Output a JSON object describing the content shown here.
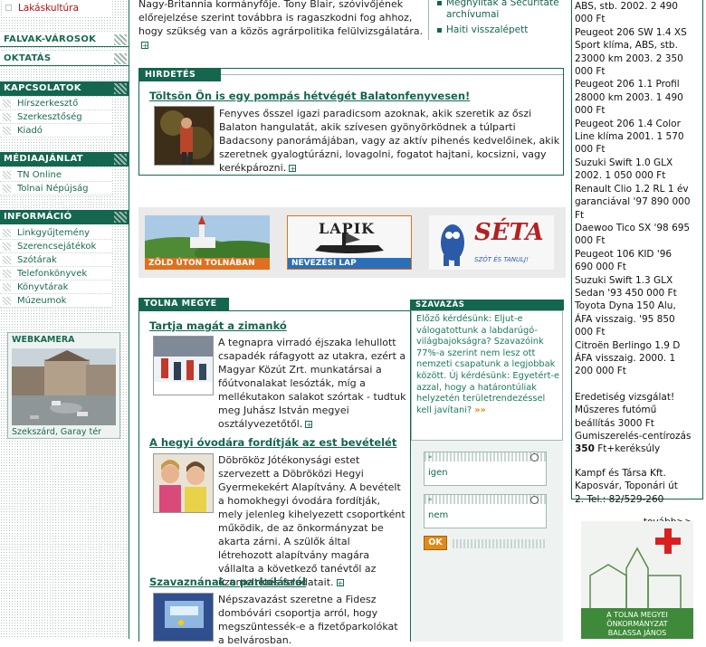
{
  "sidebar": {
    "top_link": "Lakáskultúra",
    "sections": [
      {
        "title": "FALVAK-VÁROSOK",
        "items": []
      },
      {
        "title": "OKTATÁS",
        "items": []
      },
      {
        "title": "KAPCSOLATOK",
        "items": [
          "Hírszerkesztő",
          "Szerkesztőség",
          "Kiadó"
        ]
      },
      {
        "title": "MÉDIAAJÁNLAT",
        "items": [
          "TN Online",
          "Tolnai Népújság"
        ]
      },
      {
        "title": "INFORMÁCIÓ",
        "items": [
          "Linkgyűjtemény",
          "Szerencsejátékok",
          "Szótárak",
          "Telefonkönyvek",
          "Könyvtárak",
          "Múzeumok"
        ]
      }
    ],
    "webcam": {
      "title": "WEBKAMERA",
      "caption": "Szekszárd, Garay tér"
    }
  },
  "top_article": {
    "text": "Nagy-Britannia kormányfője. Tony Blair, szóvivőjének előrejelzése szerint továbbra is ragaszkodni fog ahhoz, hogy szükség van a közös agrárpolitika felülvizsgálatára.",
    "links": [
      "Megnyíltak a Securitate archívumai",
      "Haiti visszalépett"
    ]
  },
  "ad_box": {
    "header": "HIRDETÉS",
    "headline": "Töltsön Ön is egy pompás hétvégét Balatonfenyvesen!",
    "body": "Fenyves ősszel igazi paradicsom azoknak, akik szeretik az őszi Balaton hangulatát, akik szívesen gyönyörködnek a túlparti Badacsony panorámájában, vagy az aktív pihenés kedvelőinek, akik szeretnek gyalogtúrázni, lovagolni, fogatot hajtani, kocsizni, vagy kerékpározni."
  },
  "banners": [
    {
      "label": "ZÖLD ÚTON TOLNÁBAN"
    },
    {
      "label": "NEVEZÉSI LAP",
      "logo": "LAPIK"
    },
    {
      "logo": "SÉTA",
      "sub": "SZÓT ÉS TANULJ!"
    }
  ],
  "tolna": {
    "header": "TOLNA MEGYE",
    "articles": [
      {
        "title": "Tartja magát a zimankó",
        "body": "A tegnapra virradó éjszaka lehullott csapadék ráfagyott az utakra, ezért a Magyar Közút Zrt. munkatársai a főútvonalakat lesózták, míg a mellékutakon salakot szórtak - tudtuk meg Juhász István megyei osztályvezetőtől."
      },
      {
        "title": "A hegyi óvodára fordítják az est bevételét",
        "body": "Döbrököz Jótékonysági estet szervezett a Döbröközi Hegyi Gyermekekért Alapítvány. A bevételt a homokhegyi óvodára fordítják, mely jelenleg kihelyezett csoportként működik, de az önkormányzat be akarta zárni. A szülők által létrehozott alapítvány magára vállalta a következő tanévtől az üzemeltetés feladatait."
      },
      {
        "title": "Szavaznának a parkolásról",
        "body": "Népszavazást szeretne a Fidesz dombóvári csoportja arról, hogy megszüntessék-e a fizetőparkolókat a belvárosban."
      }
    ]
  },
  "poll": {
    "header": "SZAVAZÁS",
    "text": "Előző kérdésünk: Eljut-e válogatottunk a labdarúgó-világbajokságra? Szavazóink 77%-a szerint nem lesz ott nemzeti csapatunk a legjobbak között. Új kérdésünk: Egyetért-e azzal, hogy a határontúliak helyzetén területrendezéssel kell javítani?",
    "options": [
      "igen",
      "nem"
    ],
    "ok_label": "OK"
  },
  "classifieds": {
    "lines": [
      "ABS, stb. 2002. 2 490",
      "000 Ft",
      "Peugeot 206 SW 1.4 XS",
      "Sport klíma, ABS, stb.",
      "23000 km 2003. 2 350",
      "000 Ft",
      "Peugeot 206 1.1 Profil",
      "28000 km 2003. 1 490",
      "000 Ft",
      "Peugeot 206 1.4 Color",
      "Line klíma 2001. 1 570",
      "000 Ft",
      "Suzuki Swift 1.0 GLX",
      "2002. 1 050 000 Ft",
      "Renault Clio 1.2 RL 1 év",
      "garanciával '97 890 000",
      "Ft",
      "Daewoo Tico SX '98 695",
      "000 Ft",
      "Peugeot 106 KID '96",
      "690 000 Ft",
      "Suzuki Swift 1.3 GLX",
      "Sedan '93 450 000 Ft",
      "Toyota Dyna 150 Alu,",
      "ÁFA visszaig. '95 850",
      "000 Ft",
      "Citroën Berlingo 1.9 D",
      "ÁFA visszaig. 2000. 1",
      "200 000 Ft"
    ],
    "extra_lines": [
      "Eredetiség vizsgálat!",
      "Műszeres futómű",
      "beállítás 3000 Ft",
      "Gumiszerelés-centírozás"
    ],
    "price_bold": "350",
    "price_rest": " Ft+keréksúly",
    "contact_lines": [
      "Kampf és Társa Kft.",
      "Kaposvár, Toponári út",
      "2. Tel.: 82/529-260"
    ],
    "more_link": "tovább>>"
  },
  "cross_banner": {
    "lines": [
      "A TOLNA MEGYEI",
      "ÖNKORMÁNYZAT",
      "BALASSA JÁNOS"
    ]
  }
}
